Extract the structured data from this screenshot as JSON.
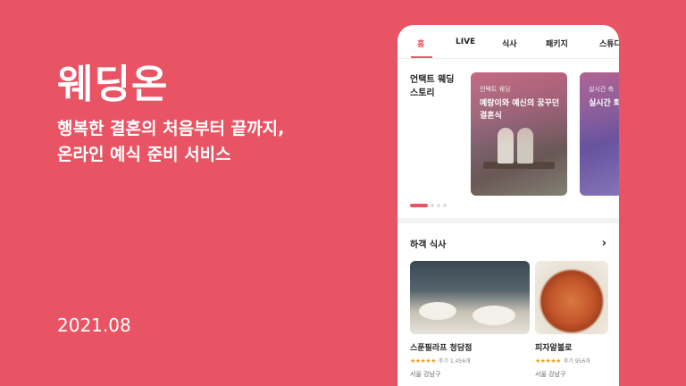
{
  "brand": "웨딩온",
  "tagline": [
    "행복한 결혼의 처음부터 끝까지,",
    "온라인 예식 준비 서비스"
  ],
  "date": "2021.08",
  "app": {
    "tabs": [
      "홈",
      "LIVE",
      "식사",
      "패키지",
      "스튜디"
    ],
    "active_tab": "홈",
    "story": {
      "title": "언택트 웨딩 스토리",
      "cards": [
        {
          "sub": "언택트 웨딩",
          "main": "예랑이와 예신의 꿈꾸던 결혼식"
        },
        {
          "sub": "실시간 축",
          "main": "실시간 화 축하멘트"
        }
      ],
      "carousel": {
        "pages": 4,
        "current": 1
      }
    },
    "section": {
      "title": "하객 식사",
      "restaurants": [
        {
          "name": "스푼필라프 청담점",
          "stars": "★★★★★",
          "reviews": "후기 1,456개",
          "location": "서울 강남구"
        },
        {
          "name": "피자알볼로",
          "stars": "★★★★★",
          "reviews": "후기 956개",
          "location": "서울 강남구"
        }
      ]
    },
    "colors": {
      "accent": "#e85463",
      "star": "#f2a01a"
    }
  }
}
